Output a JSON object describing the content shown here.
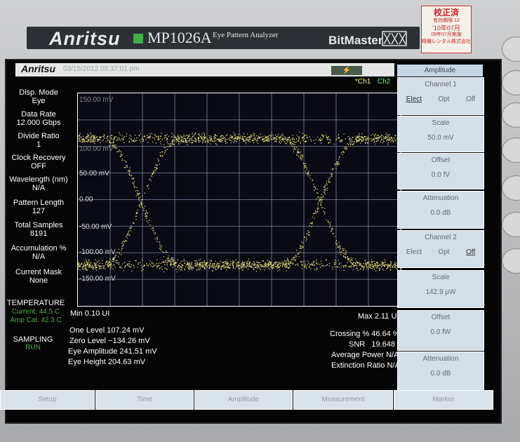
{
  "device": {
    "brand": "Anritsu",
    "model": "MP1026A",
    "subtitle": "Eye Pattern Analyzer",
    "product_name": "BitMaster",
    "sticker": {
      "title": "校正済",
      "line1": "有効期限 12",
      "line2": "'10年07月",
      "line3": "09年07月実施",
      "line4": "精機レンタル株式会社"
    }
  },
  "header": {
    "logo": "Anritsu",
    "datetime": "03/15/2012 09:37:01 pm",
    "ch1": "Ch1",
    "ch2": "Ch2"
  },
  "left_panel": [
    {
      "label": "Disp. Mode",
      "value": "Eye"
    },
    {
      "label": "Data Rate",
      "value": "12.000 Gbps"
    },
    {
      "label": "Divide Ratio",
      "value": "1"
    },
    {
      "label": "Clock Recovery",
      "value": "OFF"
    },
    {
      "label": "Wavelength (nm)",
      "value": "N/A"
    },
    {
      "label": "Pattern Length",
      "value": "127"
    },
    {
      "label": "Total Samples",
      "value": "8191"
    },
    {
      "label": "Accumulation %",
      "value": "N/A"
    },
    {
      "label": "Current Mask",
      "value": "None"
    }
  ],
  "temperature": {
    "label": "TEMPERATURE",
    "current": "Current: 44.5 C",
    "amp_cal": "Amp Cal: 42.3 C"
  },
  "sampling": {
    "label": "SAMPLING",
    "status": "RUN"
  },
  "plot": {
    "y_tick_labels": [
      "150.00 mV",
      "100.00 mV",
      "50.00 mV",
      "0.00",
      "-50.00 mV",
      "-100.00 mV",
      "-150.00 mV"
    ],
    "min_label": "Min 0.10 UI",
    "max_label": "Max 2.11 UI"
  },
  "measurements_left": [
    "One Level 107.24 mV",
    "Zero Level −134.26 mV",
    "Eye Amplitude 241.51 mV",
    "Eye Height 204.63 mV"
  ],
  "measurements_right": [
    "Crossing % 46.64 %",
    "SNR   19.648",
    "Average Power N/A",
    "Extinction Ratio N/A"
  ],
  "right_menu": {
    "title": "Amplitude",
    "channel1": {
      "label": "Channel 1",
      "options": [
        "Elect",
        "Opt",
        "Off"
      ],
      "selected": "Elect"
    },
    "scale1": {
      "label": "Scale",
      "value": "50.0 mV"
    },
    "offset1": {
      "label": "Offset",
      "value": "0.0 fV"
    },
    "atten1": {
      "label": "Attenuation",
      "value": "0.0 dB"
    },
    "channel2": {
      "label": "Channel 2",
      "options": [
        "Elect",
        "Opt",
        "Off"
      ],
      "selected": "Off"
    },
    "scale2": {
      "label": "Scale",
      "value": "142.9 μW"
    },
    "offset2": {
      "label": "Offset",
      "value": "0.0 fW"
    },
    "atten2": {
      "label": "Attenuation",
      "value": "0.0 dB"
    }
  },
  "bottom_menu": [
    "Setup",
    "Time",
    "Amplitude",
    "Measurement",
    "Marker"
  ],
  "colors": {
    "trace": "#e8e27a",
    "grid": "#7a86a0",
    "background": "#050505",
    "panel": "#d4dfe8"
  }
}
